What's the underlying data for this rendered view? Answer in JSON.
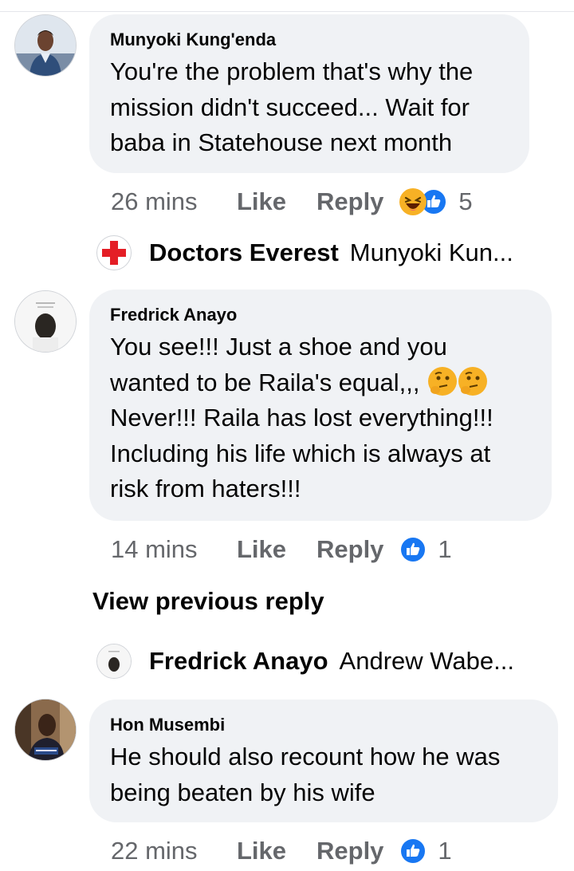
{
  "comments": [
    {
      "author": "Munyoki Kung'enda",
      "text": "You're the problem that's why the mission didn't succeed... Wait for baba in Statehouse next month",
      "time": "26 mins",
      "like_label": "Like",
      "reply_label": "Reply",
      "reaction_icons": [
        "haha-reaction-icon",
        "like-reaction-icon"
      ],
      "reaction_count": "5"
    },
    {
      "author": "Fredrick Anayo",
      "text_line1": "You see!!! Just a shoe and you",
      "text_line2": "wanted to be Raila's equal,,,",
      "text_rest": "Never!!! Raila has lost everything!!! Including his life which is always at risk from haters!!!",
      "inline_emoji": [
        "thinking-face-emoji",
        "thinking-face-emoji"
      ],
      "time": "14 mins",
      "like_label": "Like",
      "reply_label": "Reply",
      "reaction_icons": [
        "like-reaction-icon"
      ],
      "reaction_count": "1"
    },
    {
      "author": "Hon Musembi",
      "text": "He should also recount how he was being beaten by his wife",
      "time": "22 mins",
      "like_label": "Like",
      "reply_label": "Reply",
      "reaction_icons": [
        "like-reaction-icon"
      ],
      "reaction_count": "1"
    }
  ],
  "reply_previews": [
    {
      "name": "Doctors Everest",
      "text": "Munyoki Kun..."
    },
    {
      "name": "Fredrick Anayo",
      "text": "Andrew Wabe..."
    }
  ],
  "view_previous_reply": "View previous reply",
  "colors": {
    "bubble": "#f0f2f5",
    "meta_text": "#65676b",
    "like_blue": "#1877f2",
    "red_cross": "#e41e26",
    "emoji_yellow": "#f7b125"
  }
}
